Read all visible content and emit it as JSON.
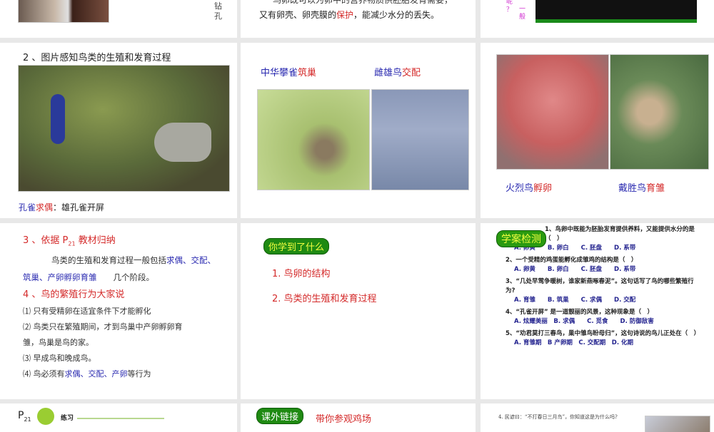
{
  "slides": [
    {
      "side_text_1": "钻",
      "side_text_2": "孔"
    },
    {
      "line_top": "鸟卵既可以为卵中的营养物质供胚胎发育需要，",
      "line_prefix": "又有卵壳、卵壳膜的",
      "line_highlight": "保护",
      "line_suffix": "，能减少水分的丢失。"
    },
    {
      "side_text_1": "呢",
      "side_text_2": "？",
      "side_text_3": "一",
      "side_text_4": "般"
    },
    {
      "title": "2 、图片感知鸟类的生殖和发育过程",
      "caption_a": "孔雀",
      "caption_b": "求偶",
      "caption_c": "：雄孔雀开屏"
    },
    {
      "label_1a": "中华攀雀",
      "label_1b": "筑巢",
      "label_2a": "雌雄鸟",
      "label_2b": "交配"
    },
    {
      "label_1a": "火烈鸟",
      "label_1b": "孵卵",
      "label_2a": "戴胜鸟",
      "label_2b": "育雏"
    },
    {
      "h3": "3 、依据 P",
      "h3_sub": "21",
      "h3_tail": " 教材归纳",
      "para_a": "鸟类的生殖和发育过程一般包括",
      "para_b": "求偶、交配、筑巢、产卵孵卵育雏",
      "para_c": "　　几个阶段。",
      "h4": "4 、鸟的繁殖行为大家说",
      "items": [
        "⑴ 只有受精卵在适宜条件下才能孵化",
        "⑵ 鸟类只在繁殖期间，才到鸟巢中产卵孵卵育雏，鸟巢是鸟的家。",
        "⑶ 早成鸟和晚成鸟。"
      ],
      "item4_a": "⑷ 鸟必须有",
      "item4_b": "求偶、交配、产卵",
      "item4_c": "等行为"
    },
    {
      "badge": "你学到了什么",
      "points": [
        "1. 鸟卵的结构",
        "2. 鸟类的生殖和发育过程"
      ]
    },
    {
      "badge": "学案检测",
      "q1": "1、鸟卵中既能为胚胎发育提供养料，又能提供水分的是（　）",
      "q1_opts": "A. 卵黄　　B. 卵白　　C. 胚盘　　D. 系带",
      "q2": "2、一个受精的鸡蛋能孵化成雏鸡的结构是（　）",
      "q2_opts": "A. 卵黄　　B. 卵白　　C. 胚盘　　D. 系带",
      "q3": "3、“几处早莺争暖树，谁家新燕啄春泥”。这句话写了鸟的哪些繁殖行为?",
      "q3_opts": "A. 育雏　　B. 筑巢　　C. 求偶　　D. 交配",
      "q4": "4、“孔雀开屏” 是一道靓丽的风景，这种现象是（　）",
      "q4_opts": "A. 炫耀美丽　B. 求偶　　C. 觅食　　D. 防御敌害",
      "q5": "5、“劝君莫打三春鸟，巢中雏鸟盼母归”，这句诗说的鸟儿正处在（　）",
      "q5_opts": "A. 育雏期　B 产卵期　C. 交配期　D. 化期"
    },
    {
      "p": "P",
      "p_sub": "21",
      "label": "练习"
    },
    {
      "badge": "课外链接",
      "title": "带你参观鸡场"
    },
    {
      "text": "4. 民谚曰：“不打春日三月鸟”，你知道这是为什么吗?"
    }
  ]
}
